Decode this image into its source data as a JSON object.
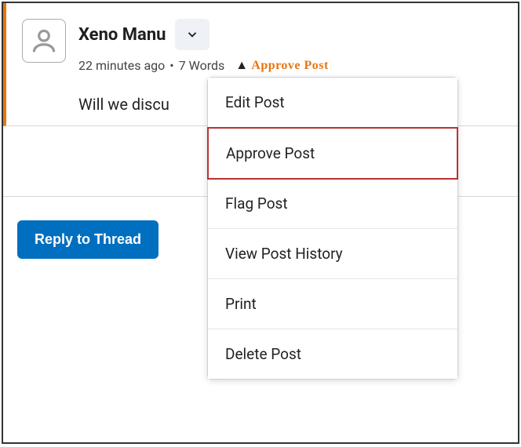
{
  "post": {
    "author": "Xeno Manu",
    "time_ago": "22 minutes ago",
    "separator": "•",
    "word_count": "7 Words",
    "behind_label_prefix": "",
    "behind_label": "Approve Post",
    "body": "Will we discu"
  },
  "reply_button_label": "Reply to Thread",
  "dropdown": {
    "items": [
      {
        "label": "Edit Post",
        "highlighted": false
      },
      {
        "label": "Approve Post",
        "highlighted": true
      },
      {
        "label": "Flag Post",
        "highlighted": false
      },
      {
        "label": "View Post History",
        "highlighted": false
      },
      {
        "label": "Print",
        "highlighted": false
      },
      {
        "label": "Delete Post",
        "highlighted": false
      }
    ]
  }
}
